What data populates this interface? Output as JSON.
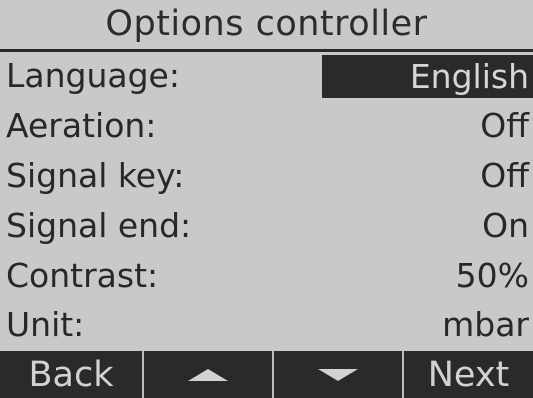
{
  "title": "Options controller",
  "options": [
    {
      "label": "Language:",
      "value": "English",
      "selected": true
    },
    {
      "label": "Aeration:",
      "value": "Off",
      "selected": false
    },
    {
      "label": "Signal key:",
      "value": "Off",
      "selected": false
    },
    {
      "label": "Signal end:",
      "value": "On",
      "selected": false
    },
    {
      "label": "Contrast:",
      "value": "50%",
      "selected": false
    },
    {
      "label": "Unit:",
      "value": "mbar",
      "selected": false
    }
  ],
  "softkeys": {
    "back": "Back",
    "up_icon": "triangle-up-icon",
    "down_icon": "triangle-down-icon",
    "next": "Next"
  },
  "colors": {
    "background": "#c9c9c9",
    "foreground": "#2a2a2a",
    "inverse_text": "#d2d2d2"
  }
}
